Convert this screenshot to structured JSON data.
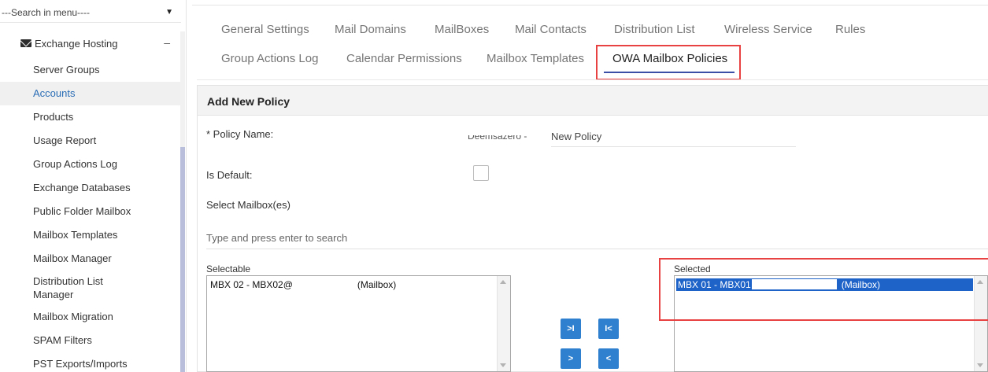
{
  "sidebar": {
    "search_label": "---Search in menu----",
    "search_caret": "▼",
    "section": {
      "label": "Exchange Hosting",
      "collapse_symbol": "–",
      "icon": "mail-icon"
    },
    "items": [
      {
        "label": "Server Groups"
      },
      {
        "label": "Accounts",
        "active": true
      },
      {
        "label": "Products"
      },
      {
        "label": "Usage Report"
      },
      {
        "label": "Group Actions Log"
      },
      {
        "label": "Exchange Databases"
      },
      {
        "label": "Public Folder Mailbox"
      },
      {
        "label": "Mailbox Templates"
      },
      {
        "label": "Mailbox Manager"
      },
      {
        "label": "Distribution List Manager"
      },
      {
        "label": "Mailbox Migration"
      },
      {
        "label": "SPAM Filters"
      },
      {
        "label": "PST Exports/Imports"
      }
    ]
  },
  "tabs": {
    "row1": [
      "General Settings",
      "Mail Domains",
      "MailBoxes",
      "Mail Contacts",
      "Distribution List",
      "Wireless Service",
      "Rules"
    ],
    "row2": [
      "Group Actions Log",
      "Calendar Permissions",
      "Mailbox Templates",
      "OWA Mailbox Policies"
    ],
    "active": "OWA Mailbox Policies"
  },
  "form": {
    "title": "Add New Policy",
    "policy_name_label": "* Policy Name:",
    "policy_prefix": "Deemsazero -",
    "policy_name_value": "New Policy",
    "is_default_label": "Is Default:",
    "is_default_checked": false,
    "select_mailboxes_label": "Select Mailbox(es)",
    "search_placeholder": "Type and press enter to search",
    "selectable_label": "Selectable",
    "selected_label": "Selected",
    "selectable_items": [
      {
        "name": "MBX 02 - MBX02@",
        "type": "(Mailbox)"
      }
    ],
    "selected_items": [
      {
        "name": "MBX 01 - MBX01",
        "type": "(Mailbox)"
      }
    ],
    "buttons": {
      "add_all": ">I",
      "remove_all": "I<",
      "add": ">",
      "remove": "<"
    }
  },
  "colors": {
    "accent": "#2f80cf",
    "highlight_box": "#e84242",
    "selection": "#1e63c8",
    "active_nav": "#2a6db5"
  }
}
